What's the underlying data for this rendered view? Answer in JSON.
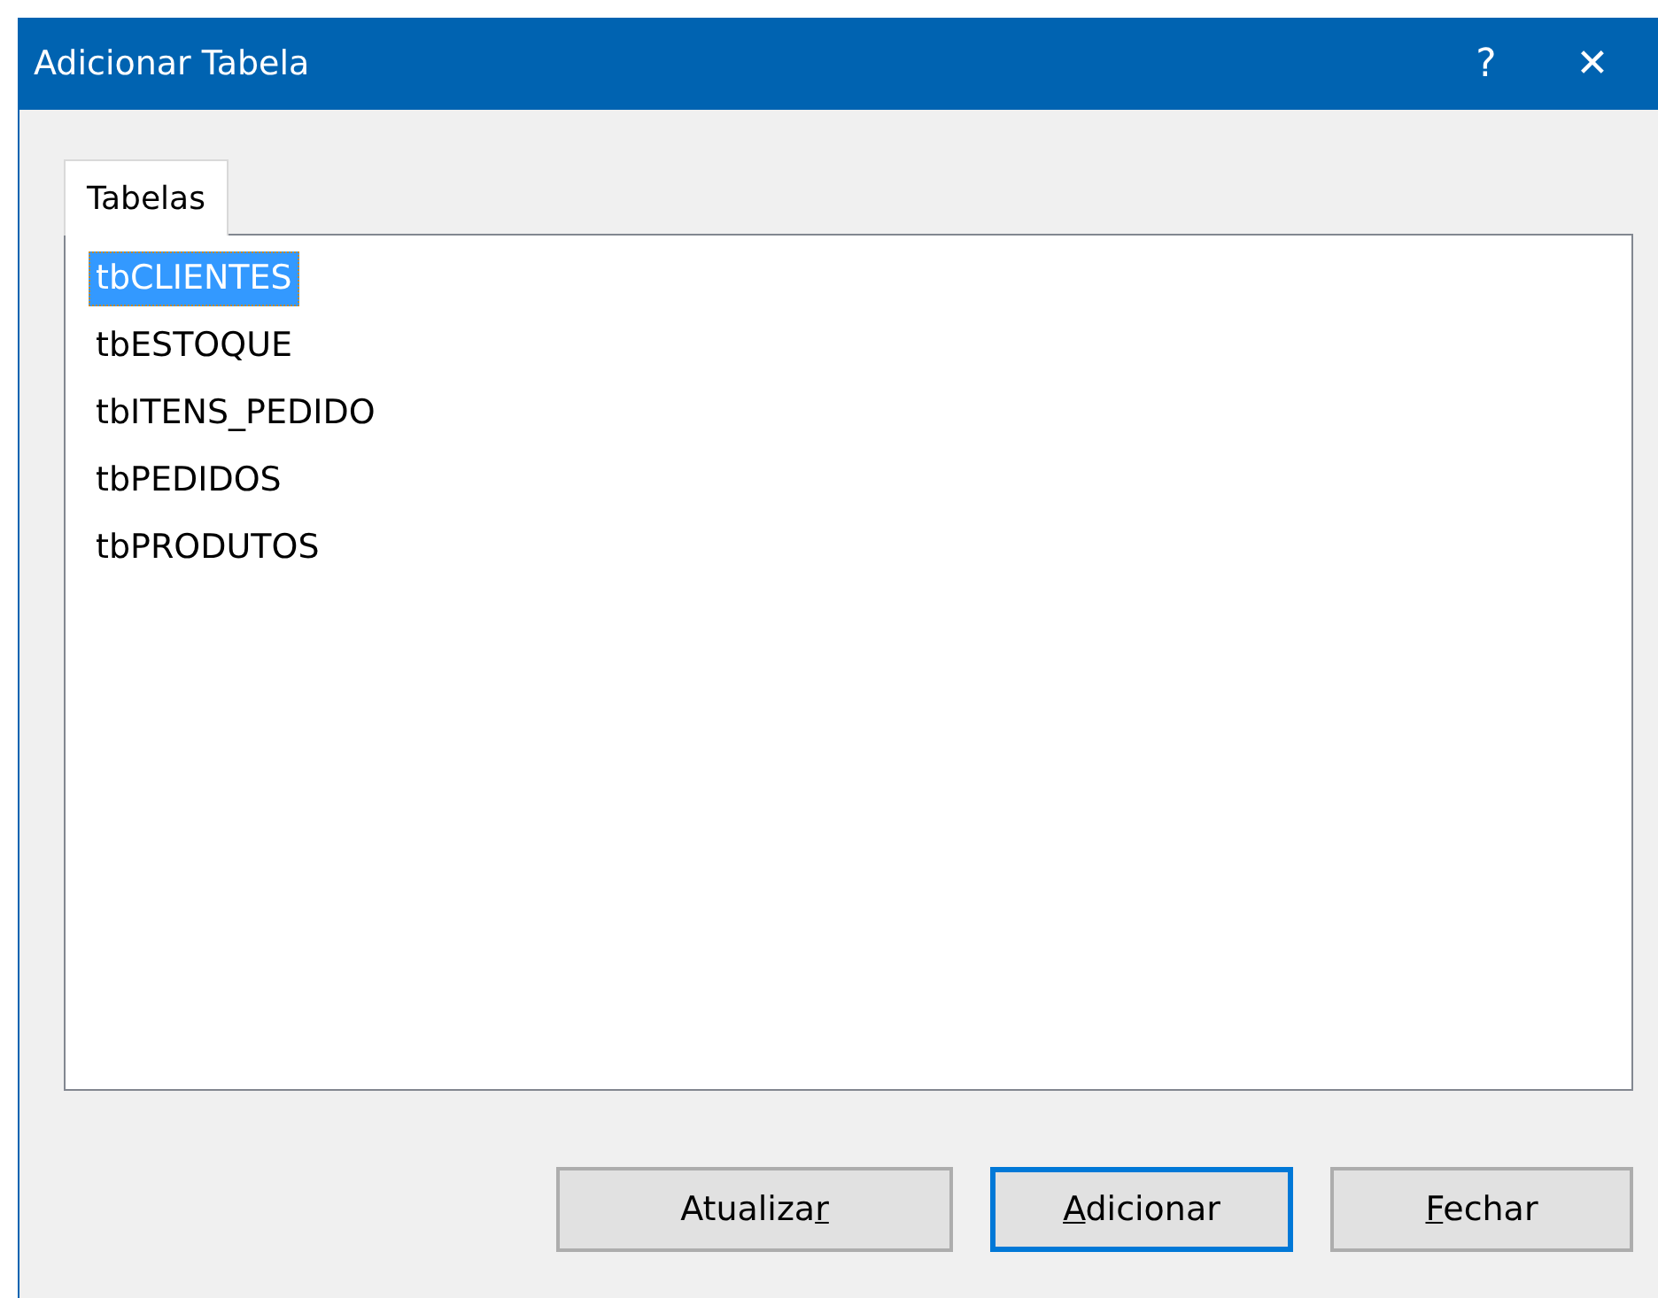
{
  "window": {
    "title": "Adicionar Tabela",
    "help": "?",
    "close": "✕"
  },
  "tabs": [
    {
      "label": "Tabelas",
      "selected": true
    }
  ],
  "tables": [
    {
      "name": "tbCLIENTES",
      "selected": true
    },
    {
      "name": "tbESTOQUE",
      "selected": false
    },
    {
      "name": "tbITENS_PEDIDO",
      "selected": false
    },
    {
      "name": "tbPEDIDOS",
      "selected": false
    },
    {
      "name": "tbPRODUTOS",
      "selected": false
    }
  ],
  "buttons": [
    {
      "label_before": "Atualiza",
      "access_key": "r",
      "default": false
    },
    {
      "access_key": "A",
      "label_after": "dicionar",
      "default": true
    },
    {
      "access_key": "F",
      "label_after": "echar",
      "default": false
    }
  ]
}
